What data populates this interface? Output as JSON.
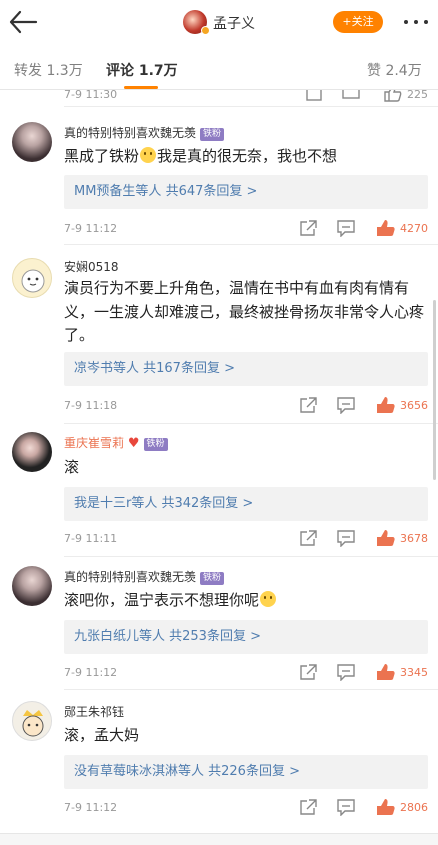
{
  "header": {
    "title": "孟子义",
    "follow_label": "+关注"
  },
  "tabs": {
    "repost": "转发 1.3万",
    "comments": "评论 1.7万",
    "likes": "赞 2.4万"
  },
  "partial_row": {
    "time": "7-9 11:30",
    "likes": "225"
  },
  "comments": [
    {
      "name": "真的特别特别喜欢魏无羡",
      "badge": "铁粉",
      "text": "黑成了铁粉",
      "text2": "我是真的很无奈，我也不想",
      "reply": "MM预备生等人  共647条回复 >",
      "time": "7-9 11:12",
      "likes": "4270"
    },
    {
      "name": "安娴0518",
      "text": "演员行为不要上升角色，温情在书中有血有肉有情有义，一生渡人却难渡己，最终被挫骨扬灰非常令人心疼了。",
      "reply": "凉岑书等人  共167条回复 >",
      "time": "7-9 11:18",
      "likes": "3656"
    },
    {
      "name": "重庆崔雪莉",
      "badge": "铁粉",
      "text": "滚",
      "reply": "我是十三r等人  共342条回复 >",
      "time": "7-9 11:11",
      "likes": "3678"
    },
    {
      "name": "真的特别特别喜欢魏无羡",
      "badge": "铁粉",
      "text": "滚吧你，温宁表示不想理你呢",
      "reply": "九张白纸儿等人  共253条回复 >",
      "time": "7-9 11:12",
      "likes": "3345"
    },
    {
      "name": "郧王朱祁钰",
      "text": "滚，孟大妈",
      "reply": "没有草莓味冰淇淋等人  共226条回复 >",
      "time": "7-9 11:12",
      "likes": "2806"
    }
  ],
  "colors": {
    "accent": "#ff8200",
    "link": "#507daf",
    "like": "#eb7350"
  },
  "icons": [
    "back-arrow-icon",
    "more-dots-icon",
    "share-icon",
    "comment-icon",
    "like-icon"
  ]
}
